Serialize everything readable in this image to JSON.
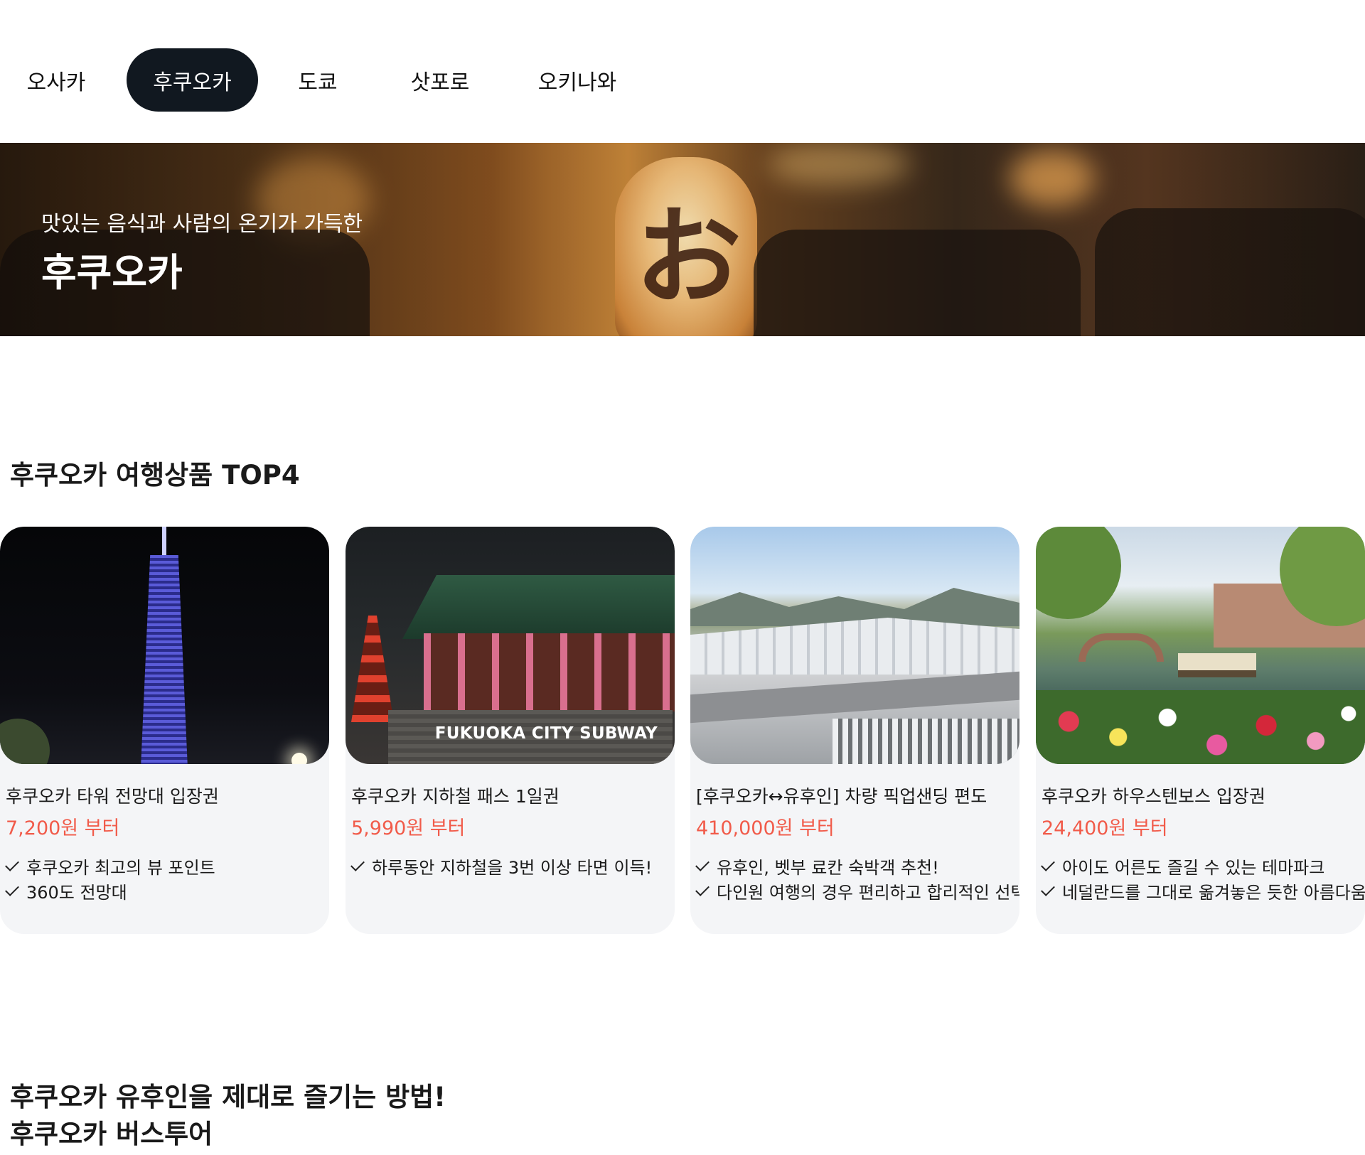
{
  "tabs": [
    {
      "label": "오사카",
      "active": false
    },
    {
      "label": "후쿠오카",
      "active": true
    },
    {
      "label": "도쿄",
      "active": false
    },
    {
      "label": "삿포로",
      "active": false
    },
    {
      "label": "오키나와",
      "active": false
    }
  ],
  "banner": {
    "subtitle": "맛있는 음식과 사람의 온기가 가득한",
    "title": "후쿠오카"
  },
  "top_products": {
    "heading": "후쿠오카 여행상품 TOP4",
    "cards": [
      {
        "image": "fukuoka-tower-night",
        "name": "후쿠오카 타워 전망대 입장권",
        "price": "7,200원 부터",
        "features": [
          "후쿠오카 최고의 뷰 포인트",
          "360도 전망대"
        ]
      },
      {
        "image": "temple-night",
        "image_caption": "FUKUOKA CITY SUBWAY",
        "name": "후쿠오카 지하철 패스 1일권",
        "price": "5,990원 부터",
        "features": [
          "하루동안 지하철을 3번 이상 타면 이득!"
        ]
      },
      {
        "image": "airport-station-aerial",
        "name": "[후쿠오카↔유후인] 차량 픽업샌딩 편도",
        "price": "410,000원 부터",
        "features": [
          "유후인, 벳부 료칸 숙박객 추천!",
          "다인원 여행의 경우 편리하고 합리적인 선택"
        ]
      },
      {
        "image": "huis-ten-bosch-canal",
        "name": "후쿠오카 하우스텐보스 입장권",
        "price": "24,400원 부터",
        "features": [
          "아이도 어른도 즐길 수 있는 테마파크",
          "네덜란드를 그대로 옮겨놓은 듯한 아름다움"
        ]
      }
    ]
  },
  "bottom_section": {
    "line1": "후쿠오카 유후인을 제대로 즐기는 방법!",
    "line2": "후쿠오카 버스투어"
  },
  "colors": {
    "active_tab_bg": "#111820",
    "price": "#f15b4a",
    "card_bg": "#f4f5f7"
  }
}
